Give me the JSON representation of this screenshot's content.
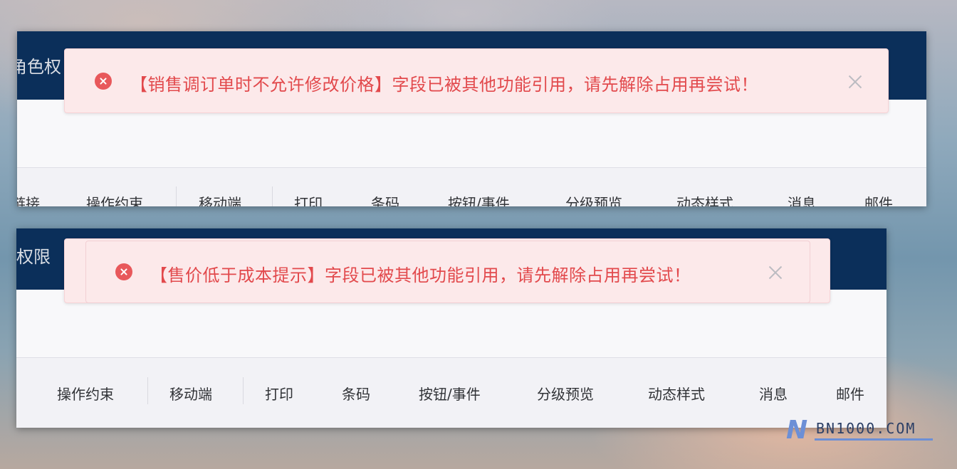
{
  "panels": [
    {
      "title": "角色权",
      "tabs": [
        "链接",
        "操作约束",
        "移动端",
        "打印",
        "条码",
        "按钮/事件",
        "分级预览",
        "动态样式",
        "消息",
        "邮件"
      ]
    },
    {
      "title": "权限",
      "tabs": [
        "操作约束",
        "移动端",
        "打印",
        "条码",
        "按钮/事件",
        "分级预览",
        "动态样式",
        "消息",
        "邮件"
      ]
    }
  ],
  "alerts": [
    {
      "icon": "error-circle-icon",
      "message": "【销售调订单时不允许修改价格】字段已被其他功能引用，请先解除占用再尝试！",
      "close_icon": "close-icon"
    },
    {
      "icon": "error-circle-icon",
      "message": "【售价低于成本提示】字段已被其他功能引用，请先解除占用再尝试！",
      "close_icon": "close-icon"
    }
  ],
  "watermark": {
    "logo_letter": "N",
    "text": "BN1000.COM"
  },
  "colors": {
    "header": "#0b2f5a",
    "alert_bg": "#fce9ea",
    "alert_text": "#e2494c",
    "error_icon": "#e8585b"
  }
}
